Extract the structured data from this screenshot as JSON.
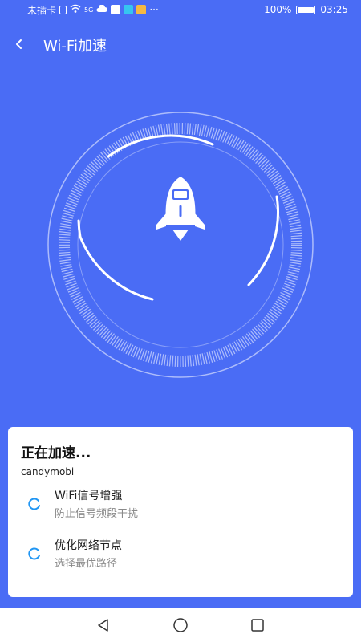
{
  "status_bar": {
    "carrier": "未插卡",
    "network": "5G",
    "battery": "100%",
    "time": "03:25",
    "more": "···"
  },
  "header": {
    "title": "Wi-Fi加速"
  },
  "card": {
    "title": "正在加速...",
    "network_name": "candymobi",
    "tasks": [
      {
        "title": "WiFi信号增强",
        "desc": "防止信号频段干扰"
      },
      {
        "title": "优化网络节点",
        "desc": "选择最优路径"
      }
    ]
  },
  "colors": {
    "background": "#4a6cf5",
    "accent": "#2196f3",
    "card": "#ffffff"
  }
}
